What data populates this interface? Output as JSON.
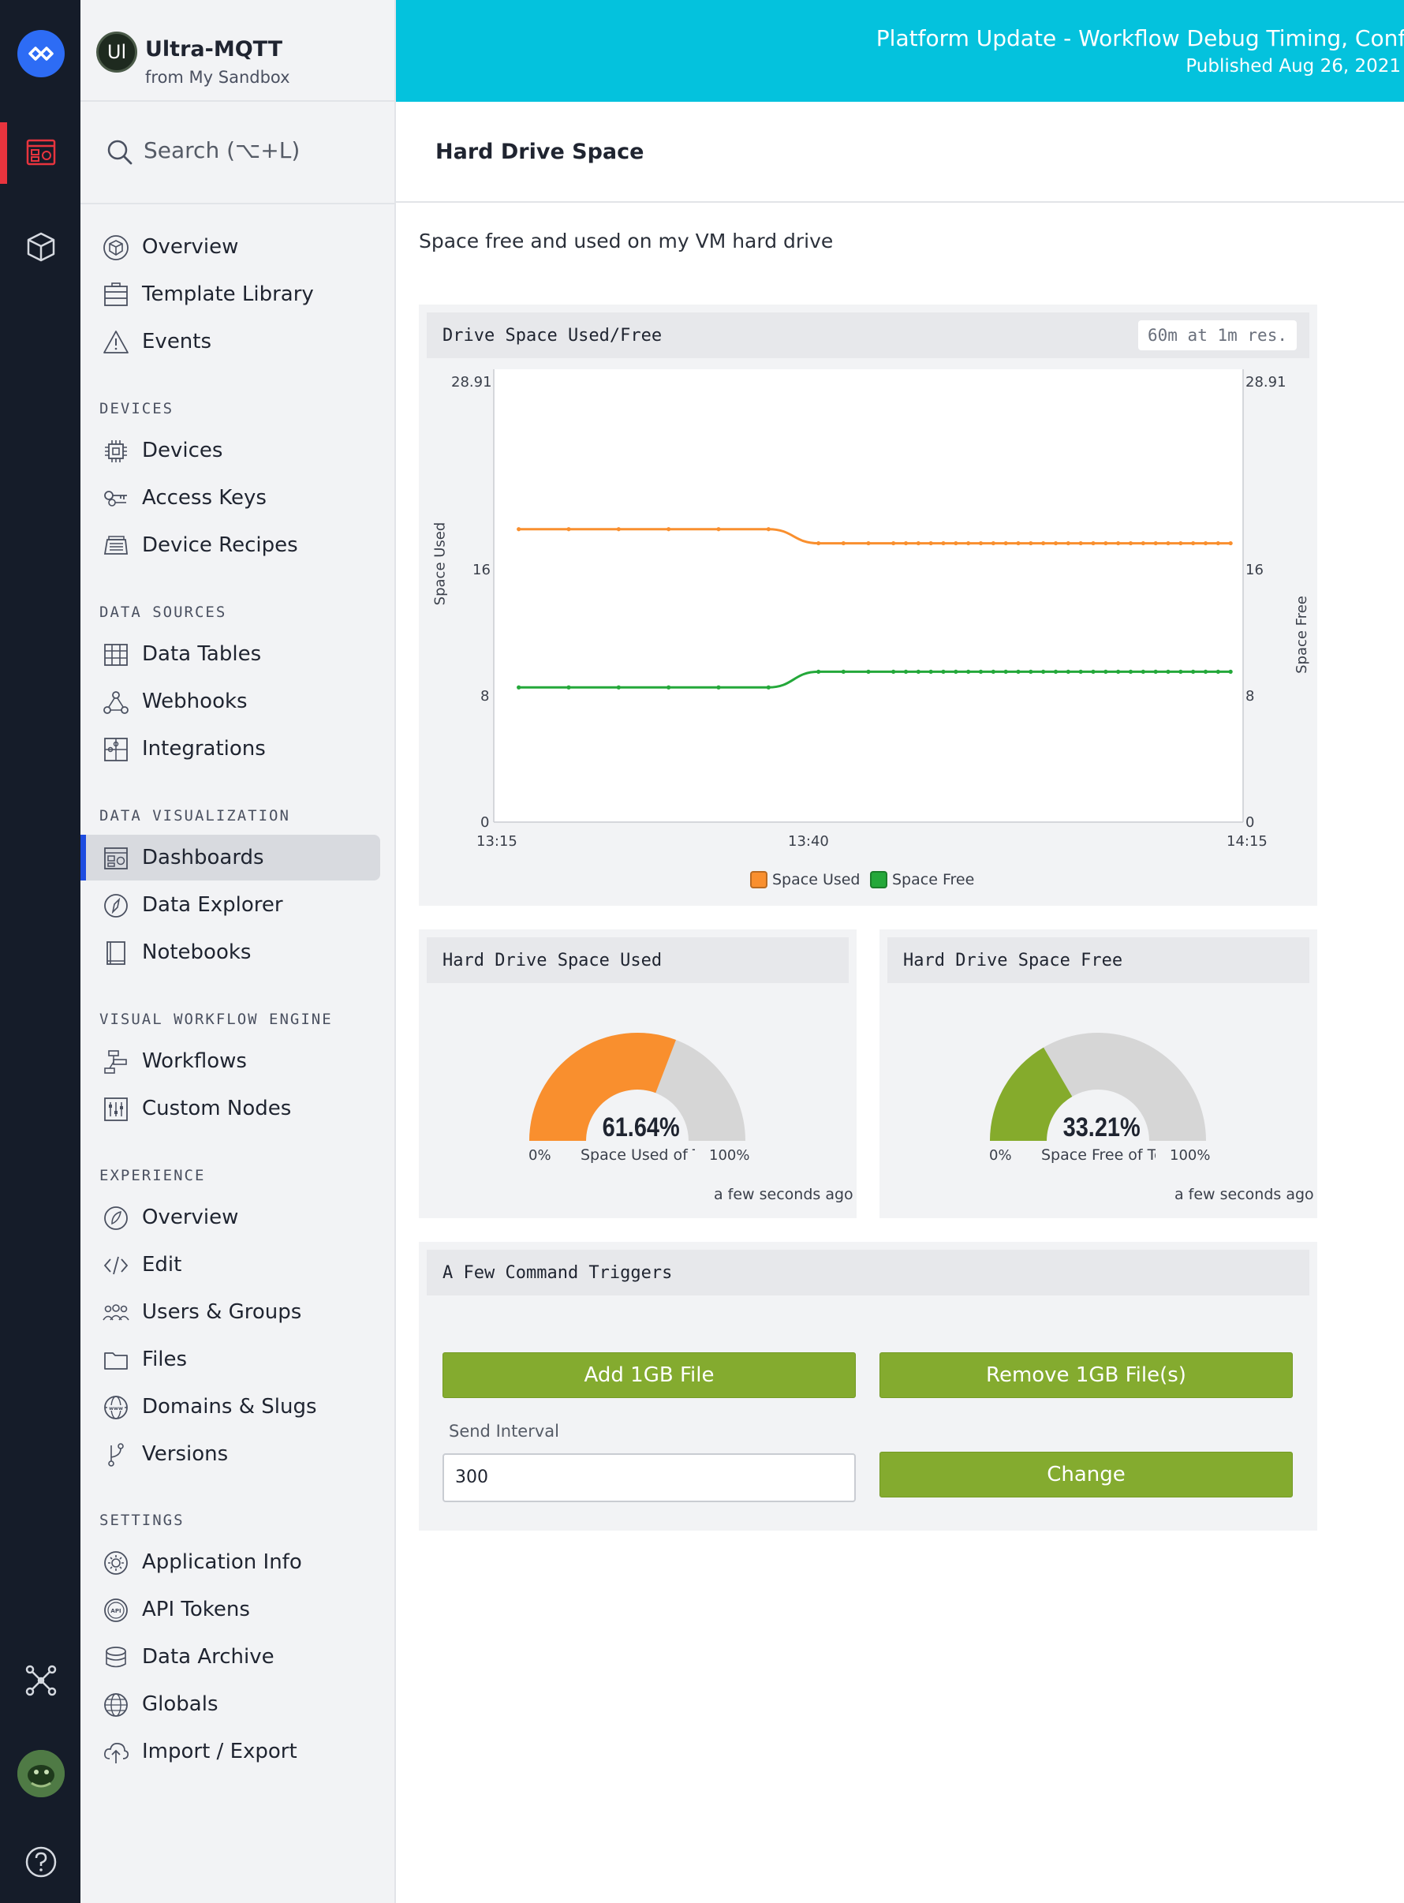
{
  "app": {
    "name": "Ultra-MQTT",
    "subtitle": "from My Sandbox",
    "avatar_initials": "Ul"
  },
  "search": {
    "label": "Search (⌥+L)"
  },
  "sidebar": {
    "top_items": [
      {
        "label": "Overview",
        "icon": "cube-outline-icon"
      },
      {
        "label": "Template Library",
        "icon": "template-icon"
      },
      {
        "label": "Events",
        "icon": "warning-triangle-icon"
      }
    ],
    "sections": [
      {
        "title": "DEVICES",
        "items": [
          {
            "label": "Devices",
            "icon": "chip-icon"
          },
          {
            "label": "Access Keys",
            "icon": "keys-icon"
          },
          {
            "label": "Device Recipes",
            "icon": "recipe-icon"
          }
        ]
      },
      {
        "title": "DATA SOURCES",
        "items": [
          {
            "label": "Data Tables",
            "icon": "table-icon"
          },
          {
            "label": "Webhooks",
            "icon": "webhook-icon"
          },
          {
            "label": "Integrations",
            "icon": "puzzle-icon"
          }
        ]
      },
      {
        "title": "DATA VISUALIZATION",
        "items": [
          {
            "label": "Dashboards",
            "icon": "dashboard-icon",
            "active": true
          },
          {
            "label": "Data Explorer",
            "icon": "compass-icon"
          },
          {
            "label": "Notebooks",
            "icon": "notebook-icon"
          }
        ]
      },
      {
        "title": "VISUAL WORKFLOW ENGINE",
        "items": [
          {
            "label": "Workflows",
            "icon": "workflow-icon"
          },
          {
            "label": "Custom Nodes",
            "icon": "sliders-icon"
          }
        ]
      },
      {
        "title": "EXPERIENCE",
        "items": [
          {
            "label": "Overview",
            "icon": "experience-icon"
          },
          {
            "label": "Edit",
            "icon": "code-icon"
          },
          {
            "label": "Users & Groups",
            "icon": "users-icon"
          },
          {
            "label": "Files",
            "icon": "folder-icon"
          },
          {
            "label": "Domains & Slugs",
            "icon": "www-globe-icon"
          },
          {
            "label": "Versions",
            "icon": "branch-icon"
          }
        ]
      },
      {
        "title": "SETTINGS",
        "items": [
          {
            "label": "Application Info",
            "icon": "gear-icon"
          },
          {
            "label": "API Tokens",
            "icon": "api-token-icon"
          },
          {
            "label": "Data Archive",
            "icon": "archive-icon"
          },
          {
            "label": "Globals",
            "icon": "globe-icon"
          },
          {
            "label": "Import / Export",
            "icon": "cloud-upload-icon"
          }
        ]
      }
    ]
  },
  "banner": {
    "title": "Platform Update - Workflow Debug Timing, Confi",
    "date": "Published Aug 26, 2021"
  },
  "page": {
    "title": "Hard Drive Space",
    "description": "Space free and used on my VM hard drive"
  },
  "colors": {
    "used": "#f98f2e",
    "free": "#24a83a",
    "free_gauge": "#85ab2c",
    "gauge_bg": "#d6d6d6",
    "button": "#84ab2f",
    "banner": "#04c2dd"
  },
  "line_panel": {
    "title": "Drive Space Used/Free",
    "resolution": "60m at 1m res.",
    "y_left_ticks": [
      "28.91",
      "16",
      "8",
      "0"
    ],
    "y_right_ticks": [
      "28.91",
      "16",
      "8",
      "0"
    ],
    "x_ticks": [
      "13:15",
      "13:40",
      "14:15"
    ],
    "y_left_label": "Space Used",
    "y_right_label": "Space Free"
  },
  "chart_data": {
    "type": "line",
    "x_range": [
      "13:15",
      "14:15"
    ],
    "ylim": [
      0,
      28.91
    ],
    "ylabel": "Space Used",
    "y2label": "Space Free",
    "series": [
      {
        "name": "Space Used",
        "color": "#f98f2e",
        "x": [
          "13:17",
          "13:21",
          "13:25",
          "13:29",
          "13:33",
          "13:37",
          "13:41",
          "13:43",
          "13:45",
          "13:47",
          "13:48",
          "13:49",
          "13:50",
          "13:51",
          "13:52",
          "13:53",
          "13:54",
          "13:55",
          "13:56",
          "13:57",
          "13:58",
          "13:59",
          "14:00",
          "14:01",
          "14:02",
          "14:03",
          "14:04",
          "14:05",
          "14:06",
          "14:07",
          "14:08",
          "14:09",
          "14:10",
          "14:11",
          "14:12",
          "14:13",
          "14:14"
        ],
        "values": [
          18.7,
          18.7,
          18.7,
          18.7,
          18.7,
          18.7,
          17.8,
          17.8,
          17.8,
          17.8,
          17.8,
          17.8,
          17.8,
          17.8,
          17.8,
          17.8,
          17.8,
          17.8,
          17.8,
          17.8,
          17.8,
          17.8,
          17.8,
          17.8,
          17.8,
          17.8,
          17.8,
          17.8,
          17.8,
          17.8,
          17.8,
          17.8,
          17.8,
          17.8,
          17.8,
          17.8,
          17.8
        ]
      },
      {
        "name": "Space Free",
        "color": "#24a83a",
        "x": [
          "13:17",
          "13:21",
          "13:25",
          "13:29",
          "13:33",
          "13:37",
          "13:41",
          "13:43",
          "13:45",
          "13:47",
          "13:48",
          "13:49",
          "13:50",
          "13:51",
          "13:52",
          "13:53",
          "13:54",
          "13:55",
          "13:56",
          "13:57",
          "13:58",
          "13:59",
          "14:00",
          "14:01",
          "14:02",
          "14:03",
          "14:04",
          "14:05",
          "14:06",
          "14:07",
          "14:08",
          "14:09",
          "14:10",
          "14:11",
          "14:12",
          "14:13",
          "14:14"
        ],
        "values": [
          8.6,
          8.6,
          8.6,
          8.6,
          8.6,
          8.6,
          9.6,
          9.6,
          9.6,
          9.6,
          9.6,
          9.6,
          9.6,
          9.6,
          9.6,
          9.6,
          9.6,
          9.6,
          9.6,
          9.6,
          9.6,
          9.6,
          9.6,
          9.6,
          9.6,
          9.6,
          9.6,
          9.6,
          9.6,
          9.6,
          9.6,
          9.6,
          9.6,
          9.6,
          9.6,
          9.6,
          9.6
        ]
      }
    ]
  },
  "gauges": [
    {
      "title": "Hard Drive Space Used",
      "value_text": "61.64%",
      "fraction": 0.6164,
      "min": "0%",
      "max": "100%",
      "label": "Space Used of Total",
      "timestamp": "a few seconds ago",
      "color": "#f98f2e"
    },
    {
      "title": "Hard Drive Space Free",
      "value_text": "33.21%",
      "fraction": 0.3321,
      "min": "0%",
      "max": "100%",
      "label": "Space Free of Total",
      "timestamp": "a few seconds ago",
      "color": "#85ab2c"
    }
  ],
  "legend": [
    "Space Used",
    "Space Free"
  ],
  "commands": {
    "title": "A Few Command Triggers",
    "add_button": "Add 1GB File",
    "remove_button": "Remove 1GB File(s)",
    "interval_label": "Send Interval",
    "interval_value": "300",
    "change_button": "Change"
  }
}
